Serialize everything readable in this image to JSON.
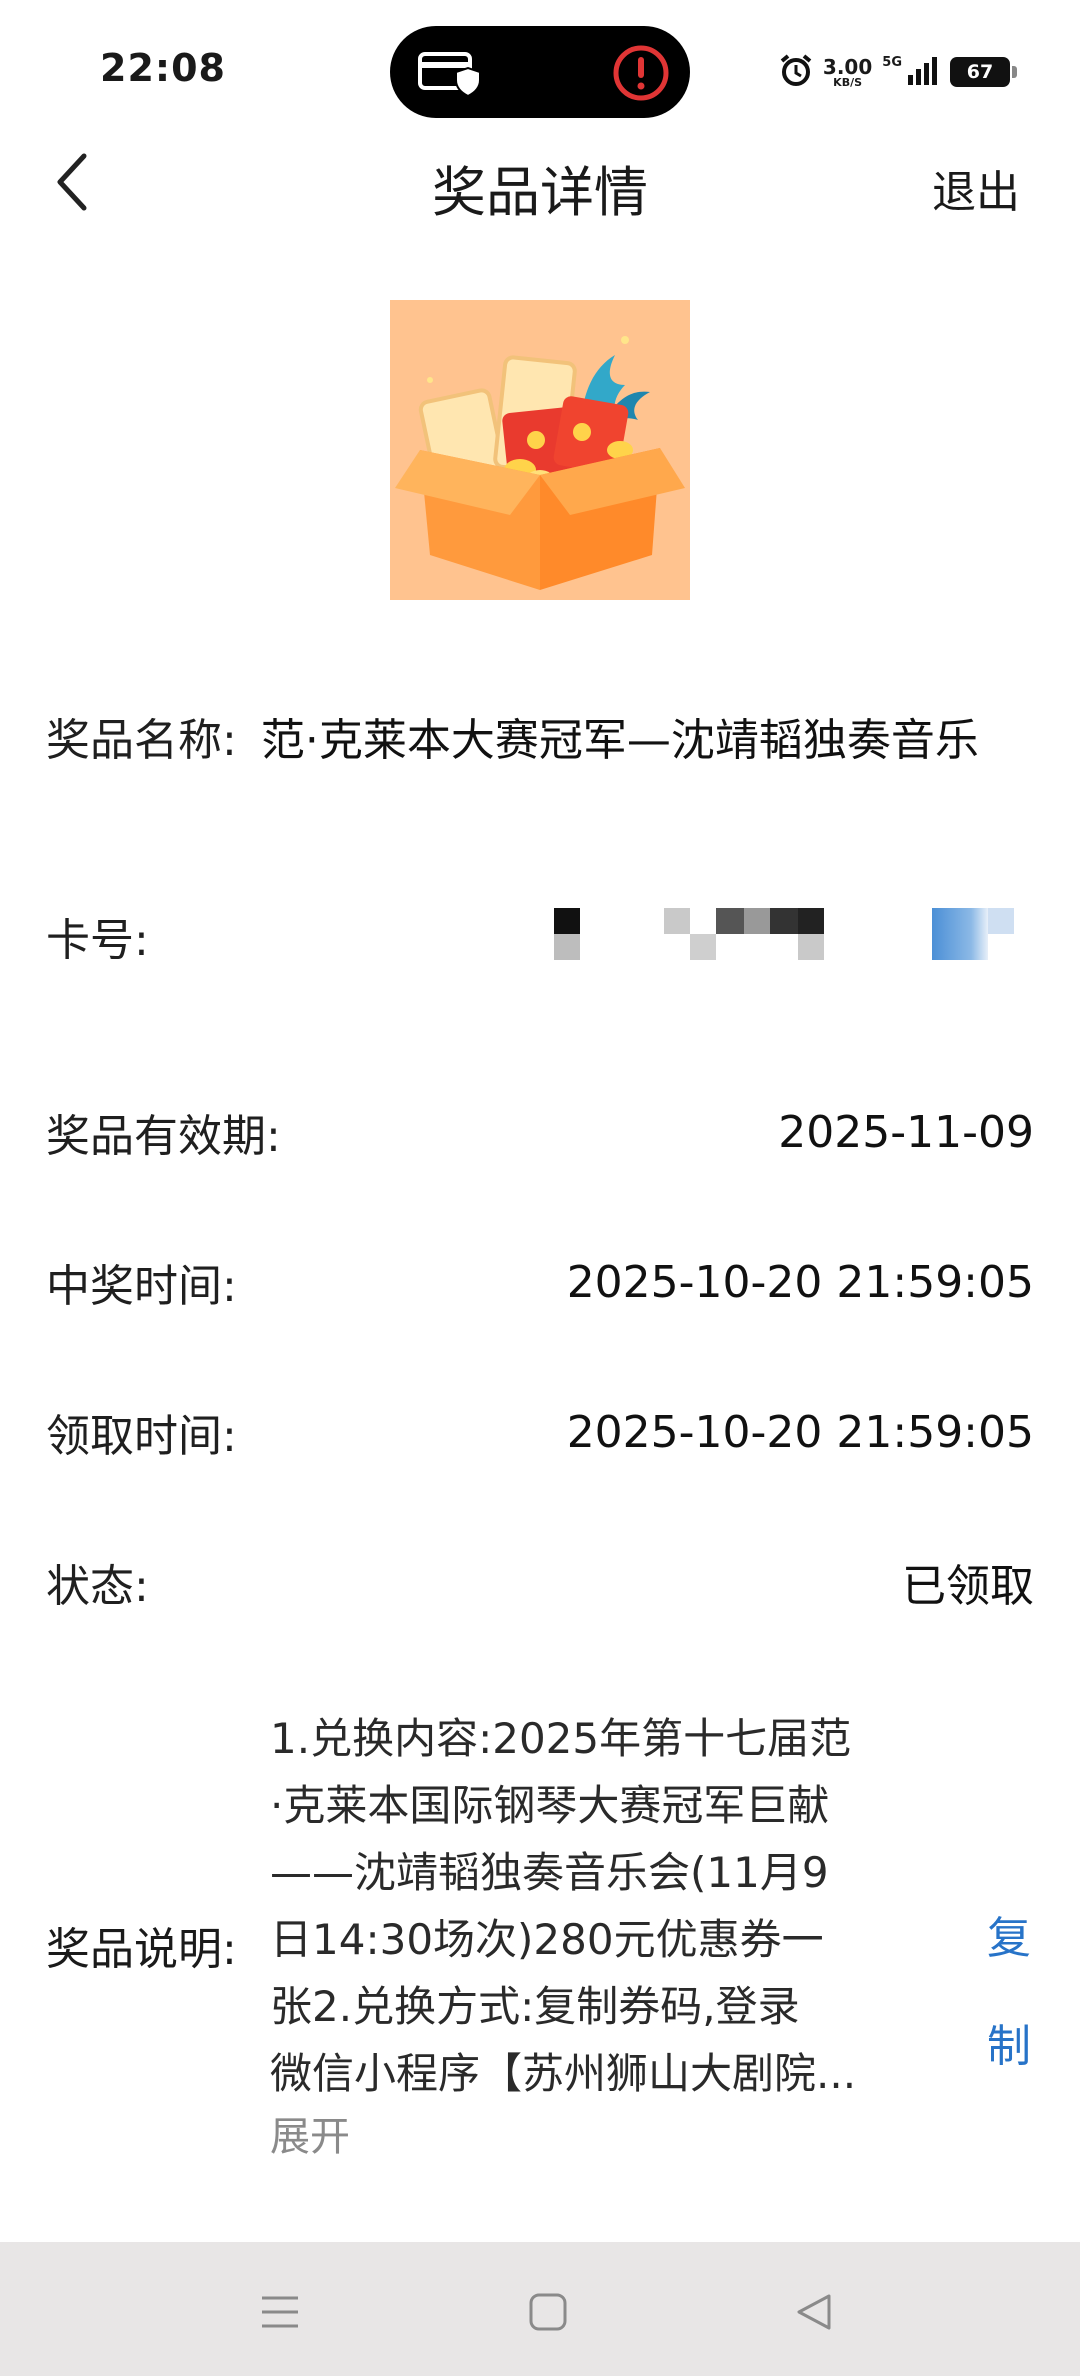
{
  "status_bar": {
    "time": "22:08",
    "net_speed": "3.00",
    "net_unit": "KB/S",
    "signal_label": "5G",
    "battery": "67",
    "icons": [
      "card-shield-icon",
      "alert-icon",
      "alarm-icon",
      "signal-icon",
      "battery-icon"
    ]
  },
  "nav": {
    "title": "奖品详情",
    "exit_label": "退出"
  },
  "prize": {
    "name_label": "奖品名称:",
    "name_value": "范·克莱本大赛冠军—沈靖韬独奏音乐",
    "card_label": "卡号:",
    "validity_label": "奖品有效期:",
    "validity_value": "2025-11-09",
    "win_time_label": "中奖时间:",
    "win_time_value": "2025-10-20 21:59:05",
    "claim_time_label": "领取时间:",
    "claim_time_value": "2025-10-20 21:59:05",
    "status_label": "状态:",
    "status_value": "已领取",
    "desc_label": "奖品说明:",
    "desc_text": "1.兑换内容:2025年第十七届范\n·克莱本国际钢琴大赛冠军巨献\n——沈靖韬独奏音乐会(11月9\n日14:30场次)280元优惠券一\n张2.兑换方式:复制券码,登录\n微信小程序【苏州狮山大剧院...",
    "expand_label": "展开",
    "copy_label": "复制"
  },
  "colors": {
    "link": "#2773c8",
    "nav_bg": "#e8e6e6",
    "image_bg": "#ffc38f"
  }
}
